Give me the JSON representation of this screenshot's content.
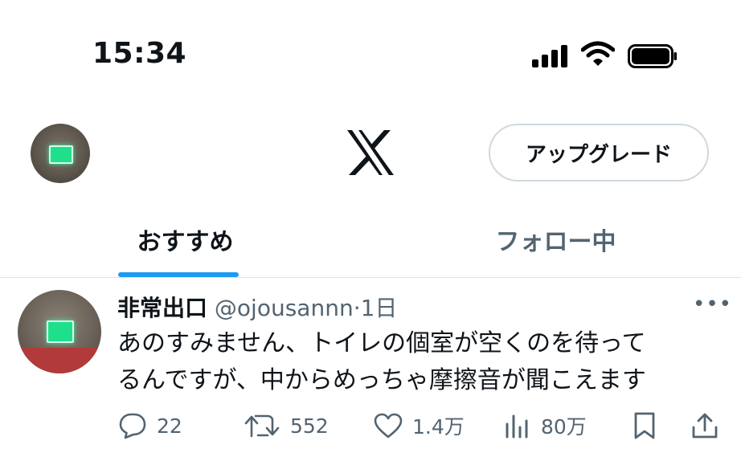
{
  "status_bar": {
    "time": "15:34"
  },
  "header": {
    "logo": "X",
    "upgrade_label": "アップグレード"
  },
  "tabs": [
    {
      "label": "おすすめ",
      "active": true
    },
    {
      "label": "フォロー中",
      "active": false
    }
  ],
  "tweet": {
    "name": "非常出口",
    "handle": "@ojousannn",
    "separator": "·",
    "time": "1日",
    "more": "•••",
    "text_line1": "あのすみません、トイレの個室が空くのを待って",
    "text_line2": "るんですが、中からめっちゃ摩擦音が聞こえます",
    "replies": "22",
    "reposts": "552",
    "likes": "1.4万",
    "views": "80万"
  },
  "colors": {
    "accent": "#1d9bf0",
    "text": "#0f1419",
    "muted": "#536471",
    "exit_sign": "#1fe08a"
  }
}
